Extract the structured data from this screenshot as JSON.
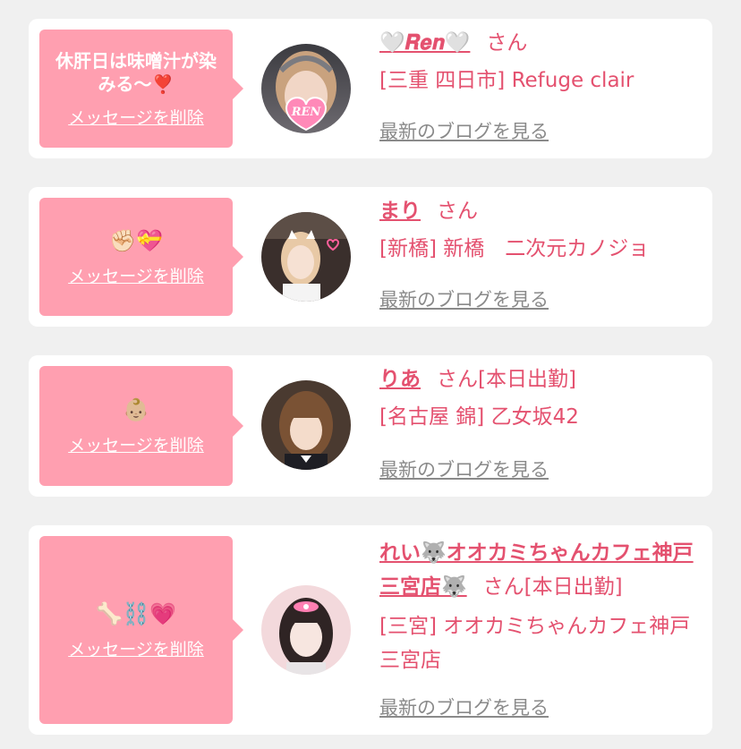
{
  "cards": [
    {
      "message": "休肝日は味噌汁が染みる〜❣️",
      "delete_label": "メッセージを削除",
      "name": "🤍𝑹𝒆𝒏🤍",
      "honorific": "さん",
      "status": "",
      "shop": "[三重 四日市] Refuge clair",
      "blog_link": "最新のブログを見る",
      "avatar_text": "REN"
    },
    {
      "message": "✊🏻💝",
      "delete_label": "メッセージを削除",
      "name": "まり",
      "honorific": "さん",
      "status": "",
      "shop": "[新橋] 新橋　二次元カノジョ",
      "blog_link": "最新のブログを見る"
    },
    {
      "message": "👶🏼",
      "delete_label": "メッセージを削除",
      "name": "りあ",
      "honorific": "さん",
      "status": "[本日出勤]",
      "shop": "[名古屋 錦] 乙女坂42",
      "blog_link": "最新のブログを見る"
    },
    {
      "message": "🦴⛓️💗",
      "delete_label": "メッセージを削除",
      "name": "れい🐺オオカミちゃんカフェ神戸三宮店🐺",
      "honorific": "さん",
      "status": "[本日出勤]",
      "shop": "[三宮] オオカミちゃんカフェ神戸三宮店",
      "blog_link": "最新のブログを見る"
    }
  ],
  "colors": {
    "accent": "#e4516f",
    "bubble": "#ff9fb0",
    "link_gray": "#8a8a8a",
    "background": "#f0f0f0"
  }
}
